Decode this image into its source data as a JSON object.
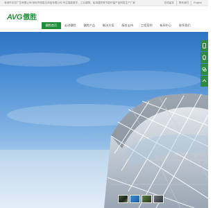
{
  "topbar": {
    "tagline": "深圳市乐凯广告有限公司/深圳市恒胜达科技有限公司 专注智能楼宇、工业建筑、民用建筑等节能环保产品研发生产厂家",
    "links": [
      "在线留言",
      "联系我们",
      "English"
    ]
  },
  "header": {
    "logo_en": "AVG",
    "logo_cn": "傲胜"
  },
  "nav": {
    "items": [
      "傲胜首页",
      "走进傲胜",
      "傲胜产品",
      "解决方案",
      "服务支持",
      "工程案例",
      "新闻中心",
      "联系我们"
    ],
    "active_index": 0
  },
  "sidebar": {
    "buttons": [
      "phone-icon",
      "qq-icon",
      "wechat-icon",
      "top-icon"
    ]
  },
  "slider": {
    "count": 4,
    "active_index": 1
  },
  "colors": {
    "brand": "#1f8f3a",
    "sidebar": "#2e8b44"
  }
}
